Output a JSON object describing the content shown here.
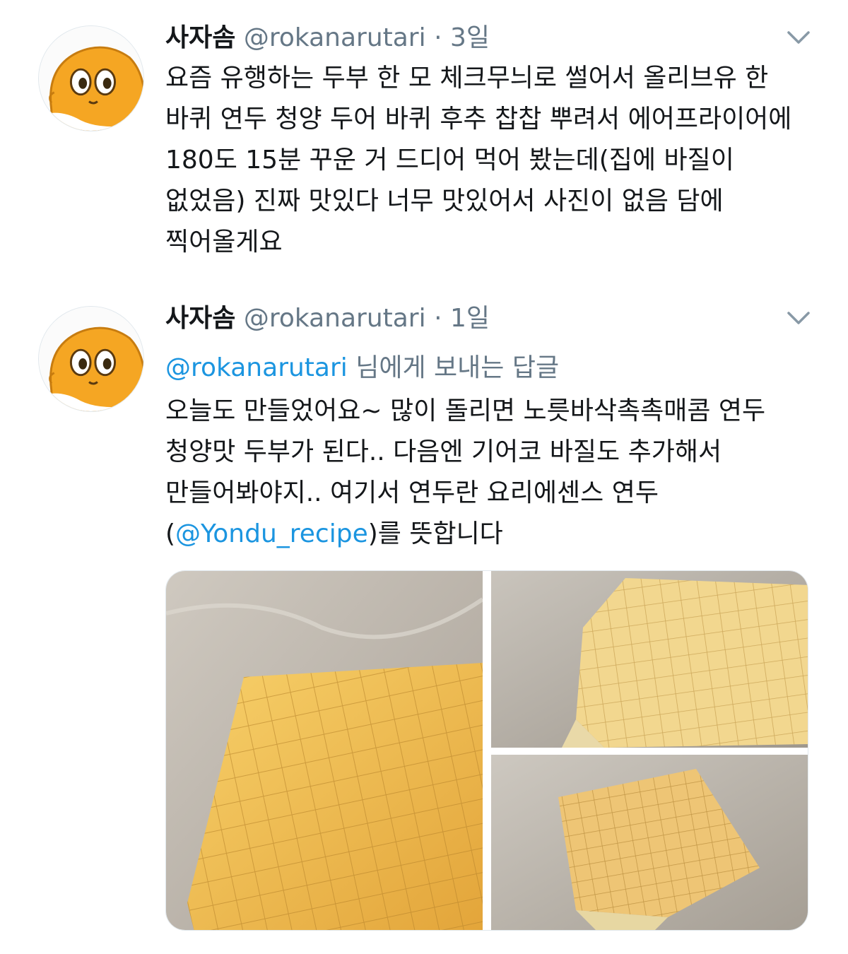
{
  "tweets": [
    {
      "name": "사자솜",
      "handle": "@rokanarutari",
      "separator": "·",
      "time": "3일",
      "text": "요즘 유행하는 두부 한 모 체크무늬로 썰어서 올리브유 한 바퀴 연두 청양 두어 바퀴 후추 찹찹 뿌려서 에어프라이어에 180도 15분 꾸운 거 드디어 먹어 봤는데(집에 바질이 없었음) 진짜 맛있다 너무 맛있어서 사진이 없음 담에 찍어올게요"
    },
    {
      "name": "사자솜",
      "handle": "@rokanarutari",
      "separator": "·",
      "time": "1일",
      "reply_handle": "@rokanarutari",
      "reply_suffix": " 님에게 보내는 답글",
      "text_part1": "오늘도 만들었어요~ 많이 돌리면 노릇바삭촉촉매콤 연두 청양맛 두부가 된다.. 다음엔 기어코 바질도 추가해서 만들어봐야지.. 여기서 연두란 요리에센스 연두(",
      "mention": "@Yondu_recipe",
      "text_part2": ")를 뜻합니다"
    }
  ],
  "icons": {
    "more": "chevron-down-icon",
    "avatar": "orange-character-avatar"
  },
  "colors": {
    "text": "#14171a",
    "secondary": "#657786",
    "link": "#1b95e0",
    "avatar_fill": "#f5a623",
    "tofu": "#f0c05a"
  }
}
